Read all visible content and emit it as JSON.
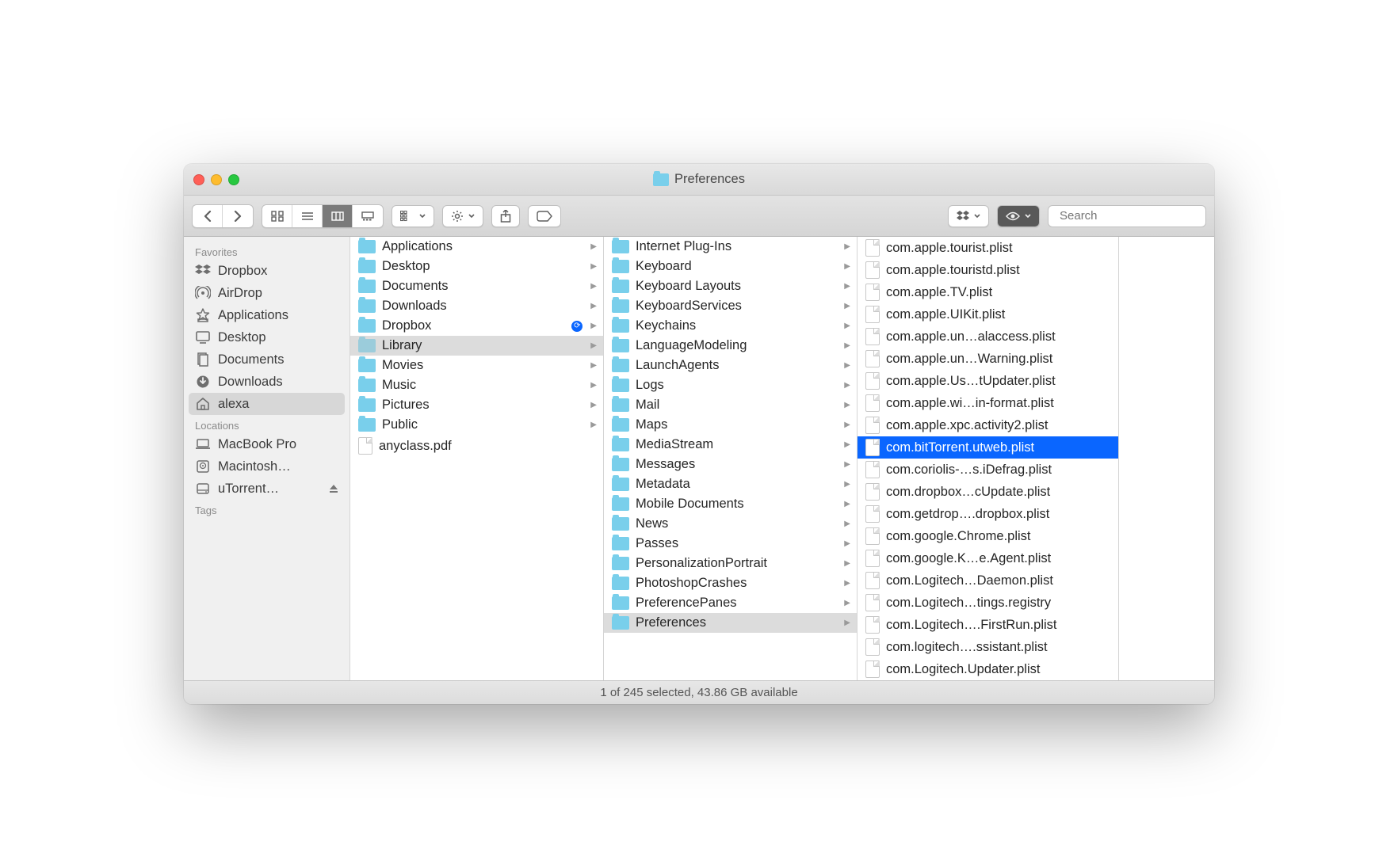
{
  "window": {
    "title": "Preferences"
  },
  "toolbar": {
    "search_placeholder": "Search"
  },
  "sidebar": {
    "sections": [
      {
        "heading": "Favorites",
        "items": [
          {
            "label": "Dropbox",
            "icon": "dropbox"
          },
          {
            "label": "AirDrop",
            "icon": "airdrop"
          },
          {
            "label": "Applications",
            "icon": "apps"
          },
          {
            "label": "Desktop",
            "icon": "desktop"
          },
          {
            "label": "Documents",
            "icon": "documents"
          },
          {
            "label": "Downloads",
            "icon": "downloads"
          },
          {
            "label": "alexa",
            "icon": "home",
            "selected": true
          }
        ]
      },
      {
        "heading": "Locations",
        "items": [
          {
            "label": "MacBook Pro",
            "icon": "laptop"
          },
          {
            "label": "Macintosh…",
            "icon": "hdd"
          },
          {
            "label": "uTorrent…",
            "icon": "disk",
            "eject": true
          }
        ]
      },
      {
        "heading": "Tags",
        "items": []
      }
    ]
  },
  "columns": [
    {
      "items": [
        {
          "label": "Applications",
          "type": "folder",
          "has_children": true
        },
        {
          "label": "Desktop",
          "type": "folder",
          "has_children": true
        },
        {
          "label": "Documents",
          "type": "folder",
          "has_children": true
        },
        {
          "label": "Downloads",
          "type": "folder",
          "has_children": true
        },
        {
          "label": "Dropbox",
          "type": "folder",
          "has_children": true,
          "sync": true
        },
        {
          "label": "Library",
          "type": "folder",
          "has_children": true,
          "selected": "gray",
          "dim": true
        },
        {
          "label": "Movies",
          "type": "folder",
          "has_children": true
        },
        {
          "label": "Music",
          "type": "folder",
          "has_children": true
        },
        {
          "label": "Pictures",
          "type": "folder",
          "has_children": true
        },
        {
          "label": "Public",
          "type": "folder",
          "has_children": true
        },
        {
          "label": "anyclass.pdf",
          "type": "file"
        }
      ]
    },
    {
      "items": [
        {
          "label": "Internet Plug-Ins",
          "type": "folder",
          "has_children": true
        },
        {
          "label": "Keyboard",
          "type": "folder",
          "has_children": true
        },
        {
          "label": "Keyboard Layouts",
          "type": "folder",
          "has_children": true
        },
        {
          "label": "KeyboardServices",
          "type": "folder",
          "has_children": true
        },
        {
          "label": "Keychains",
          "type": "folder",
          "has_children": true
        },
        {
          "label": "LanguageModeling",
          "type": "folder",
          "has_children": true
        },
        {
          "label": "LaunchAgents",
          "type": "folder",
          "has_children": true
        },
        {
          "label": "Logs",
          "type": "folder",
          "has_children": true
        },
        {
          "label": "Mail",
          "type": "folder",
          "has_children": true
        },
        {
          "label": "Maps",
          "type": "folder",
          "has_children": true
        },
        {
          "label": "MediaStream",
          "type": "folder",
          "has_children": true
        },
        {
          "label": "Messages",
          "type": "folder",
          "has_children": true
        },
        {
          "label": "Metadata",
          "type": "folder",
          "has_children": true
        },
        {
          "label": "Mobile Documents",
          "type": "folder",
          "has_children": true
        },
        {
          "label": "News",
          "type": "folder",
          "has_children": true
        },
        {
          "label": "Passes",
          "type": "folder",
          "has_children": true
        },
        {
          "label": "PersonalizationPortrait",
          "type": "folder",
          "has_children": true
        },
        {
          "label": "PhotoshopCrashes",
          "type": "folder",
          "has_children": true
        },
        {
          "label": "PreferencePanes",
          "type": "folder",
          "has_children": true
        },
        {
          "label": "Preferences",
          "type": "folder",
          "has_children": true,
          "selected": "gray"
        }
      ]
    },
    {
      "items": [
        {
          "label": "com.apple.tourist.plist",
          "type": "file"
        },
        {
          "label": "com.apple.touristd.plist",
          "type": "file"
        },
        {
          "label": "com.apple.TV.plist",
          "type": "file"
        },
        {
          "label": "com.apple.UIKit.plist",
          "type": "file"
        },
        {
          "label": "com.apple.un…alaccess.plist",
          "type": "file"
        },
        {
          "label": "com.apple.un…Warning.plist",
          "type": "file"
        },
        {
          "label": "com.apple.Us…tUpdater.plist",
          "type": "file"
        },
        {
          "label": "com.apple.wi…in-format.plist",
          "type": "file"
        },
        {
          "label": "com.apple.xpc.activity2.plist",
          "type": "file"
        },
        {
          "label": "com.bitTorrent.utweb.plist",
          "type": "file",
          "selected": "blue"
        },
        {
          "label": "com.coriolis-…s.iDefrag.plist",
          "type": "file"
        },
        {
          "label": "com.dropbox…cUpdate.plist",
          "type": "file"
        },
        {
          "label": "com.getdrop….dropbox.plist",
          "type": "file"
        },
        {
          "label": "com.google.Chrome.plist",
          "type": "file"
        },
        {
          "label": "com.google.K…e.Agent.plist",
          "type": "file"
        },
        {
          "label": "com.Logitech…Daemon.plist",
          "type": "file"
        },
        {
          "label": "com.Logitech…tings.registry",
          "type": "file"
        },
        {
          "label": "com.Logitech….FirstRun.plist",
          "type": "file"
        },
        {
          "label": "com.logitech….ssistant.plist",
          "type": "file"
        },
        {
          "label": "com.Logitech.Updater.plist",
          "type": "file"
        }
      ]
    }
  ],
  "status": {
    "text": "1 of 245 selected, 43.86 GB available"
  }
}
